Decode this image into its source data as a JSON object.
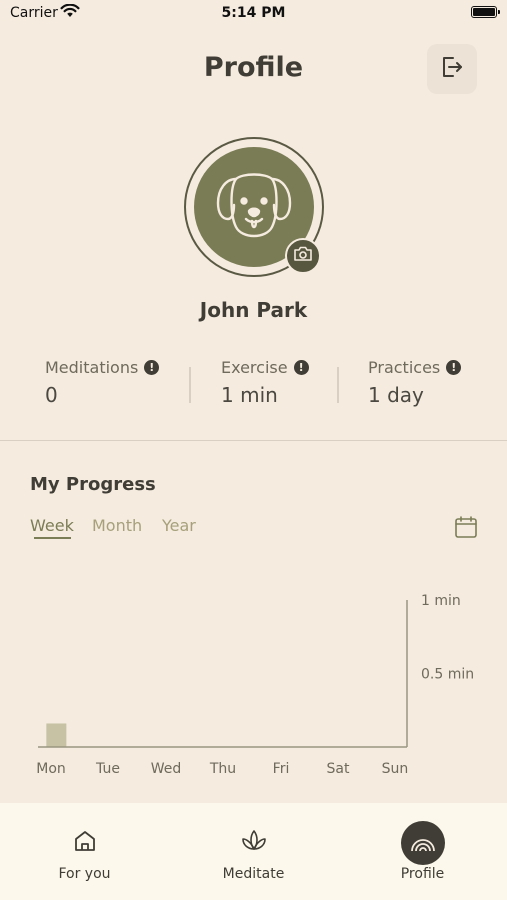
{
  "status_bar": {
    "carrier": "Carrier",
    "time": "5:14 PM"
  },
  "header": {
    "title": "Profile",
    "logout_icon": "logout-icon"
  },
  "profile": {
    "name": "John Park",
    "avatar_icon": "dog-face-icon",
    "camera_icon": "camera-icon"
  },
  "stats": [
    {
      "label": "Meditations",
      "value": "0"
    },
    {
      "label": "Exercise",
      "value": "1 min"
    },
    {
      "label": "Practices",
      "value": "1 day"
    }
  ],
  "progress": {
    "title": "My Progress",
    "tabs": [
      "Week",
      "Month",
      "Year"
    ],
    "active_tab": "Week",
    "calendar_icon": "calendar-icon"
  },
  "chart_data": {
    "type": "bar",
    "categories": [
      "Mon",
      "Tue",
      "Wed",
      "Thu",
      "Fri",
      "Sat",
      "Sun"
    ],
    "values": [
      0.16,
      0,
      0,
      0,
      0,
      0,
      0
    ],
    "y_ticks": [
      {
        "value": 1,
        "label": "1 min"
      },
      {
        "value": 0.5,
        "label": "0.5 min"
      }
    ],
    "ylim": [
      0,
      1
    ],
    "y_axis_side": "right",
    "bar_color": "#c6c2a3"
  },
  "tab_bar": {
    "items": [
      {
        "label": "For you",
        "icon": "home-icon",
        "active": false
      },
      {
        "label": "Meditate",
        "icon": "lotus-icon",
        "active": false
      },
      {
        "label": "Profile",
        "icon": "profile-rings-icon",
        "active": true
      }
    ]
  },
  "colors": {
    "background": "#f5ebdf",
    "accent": "#7a7c56",
    "dark": "#3f3d35",
    "tab_bar": "#fcf8ec"
  }
}
